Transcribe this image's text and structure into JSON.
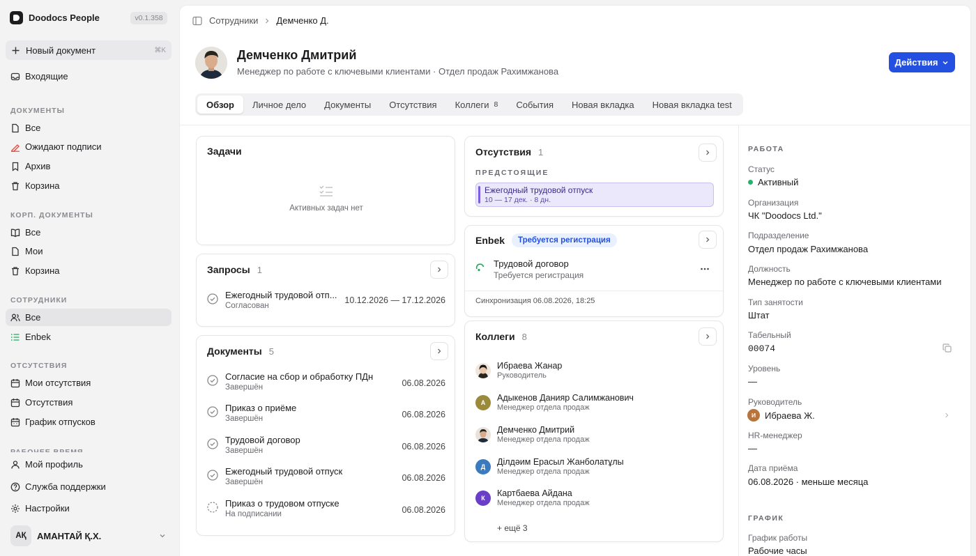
{
  "app": {
    "name": "Doodocs People",
    "version": "v0.1.358"
  },
  "sidebar": {
    "new_document": {
      "label": "Новый документ",
      "shortcut": "⌘K"
    },
    "inbox": "Входящие",
    "sections": [
      {
        "title": "ДОКУМЕНТЫ",
        "items": [
          "Все",
          "Ожидают подписи",
          "Архив",
          "Корзина"
        ]
      },
      {
        "title": "КОРП. ДОКУМЕНТЫ",
        "items": [
          "Все",
          "Мои",
          "Корзина"
        ]
      },
      {
        "title": "СОТРУДНИКИ",
        "items": [
          "Все",
          "Enbek"
        ]
      },
      {
        "title": "ОТСУТСТВИЯ",
        "items": [
          "Мои отсутствия",
          "Отсутствия",
          "График отпусков"
        ]
      },
      {
        "title": "РАБОЧЕЕ ВРЕМЯ",
        "items": []
      }
    ],
    "bottom": [
      "Мой профиль",
      "Служба поддержки",
      "Настройки"
    ],
    "user": {
      "initials": "AҚ",
      "name": "АМАНТАЙ Қ.Х."
    }
  },
  "breadcrumb": {
    "parent": "Сотрудники",
    "current": "Демченко Д."
  },
  "employee": {
    "name": "Демченко Дмитрий",
    "subtitle": "Менеджер по работе с ключевыми клиентами · Отдел продаж Рахимжанова",
    "actions_label": "Действия"
  },
  "tabs": [
    {
      "label": "Обзор",
      "count": ""
    },
    {
      "label": "Личное дело",
      "count": ""
    },
    {
      "label": "Документы",
      "count": ""
    },
    {
      "label": "Отсутствия",
      "count": ""
    },
    {
      "label": "Коллеги",
      "count": "8"
    },
    {
      "label": "События",
      "count": ""
    },
    {
      "label": "Новая вкладка",
      "count": ""
    },
    {
      "label": "Новая вкладка test",
      "count": ""
    }
  ],
  "tasks": {
    "title": "Задачи",
    "empty": "Активных задач нет"
  },
  "requests": {
    "title": "Запросы",
    "count": "1",
    "items": [
      {
        "title": "Ежегодный трудовой отп...",
        "status": "Согласован",
        "dates": "10.12.2026 — 17.12.2026"
      }
    ]
  },
  "documents": {
    "title": "Документы",
    "count": "5",
    "items": [
      {
        "title": "Согласие на сбор и обработку ПДн",
        "status": "Завершён",
        "date": "06.08.2026"
      },
      {
        "title": "Приказ о приёме",
        "status": "Завершён",
        "date": "06.08.2026"
      },
      {
        "title": "Трудовой договор",
        "status": "Завершён",
        "date": "06.08.2026"
      },
      {
        "title": "Ежегодный трудовой отпуск",
        "status": "Завершён",
        "date": "06.08.2026"
      },
      {
        "title": "Приказ о трудовом отпуске",
        "status": "На подписании",
        "date": "06.08.2026"
      }
    ]
  },
  "absences": {
    "title": "Отсутствия",
    "count": "1",
    "section": "ПРЕДСТОЯЩИЕ",
    "upcoming": {
      "title": "Ежегодный трудовой отпуск",
      "period": "10 — 17 дек. · 8 дн."
    }
  },
  "enbek": {
    "title": "Enbek",
    "badge": "Требуется регистрация",
    "item_title": "Трудовой договор",
    "item_status": "Требуется регистрация",
    "sync": "Синхронизация 06.08.2026, 18:25"
  },
  "colleagues": {
    "title": "Коллеги",
    "count": "8",
    "items": [
      {
        "name": "Ибраева Жанар",
        "role": "Руководитель",
        "initial": "",
        "color": "#f0e6dc"
      },
      {
        "name": "Адыкенов Данияр Салимжанович",
        "role": "Менеджер отдела продаж",
        "initial": "А",
        "color": "#9a8a3a"
      },
      {
        "name": "Демченко Дмитрий",
        "role": "Менеджер отдела продаж",
        "initial": "",
        "color": "#e8e2da"
      },
      {
        "name": "Ділдәим Ерасыл Жанболатұлы",
        "role": "Менеджер отдела продаж",
        "initial": "Д",
        "color": "#3a7bbf"
      },
      {
        "name": "Картбаева Айдана",
        "role": "Менеджер отдела продаж",
        "initial": "К",
        "color": "#6a3fc8"
      }
    ],
    "more": "+ ещё 3"
  },
  "work": {
    "title": "РАБОТА",
    "fields": [
      {
        "label": "Статус",
        "value": "Активный"
      },
      {
        "label": "Организация",
        "value": "ЧК \"Doodocs Ltd.\""
      },
      {
        "label": "Подразделение",
        "value": "Отдел продаж Рахимжанова"
      },
      {
        "label": "Должность",
        "value": "Менеджер по работе с ключевыми клиентами"
      },
      {
        "label": "Тип занятости",
        "value": "Штат"
      },
      {
        "label": "Табельный",
        "value": "00074"
      },
      {
        "label": "Уровень",
        "value": "—"
      },
      {
        "label": "Руководитель",
        "value": "Ибраева Ж.",
        "initial": "И"
      },
      {
        "label": "HR-менеджер",
        "value": "—"
      },
      {
        "label": "Дата приёма",
        "value": "06.08.2026 · меньше месяца"
      }
    ]
  },
  "schedule": {
    "title": "ГРАФИК",
    "label": "График работы",
    "value": "Рабочие часы"
  },
  "colors": {
    "accent": "#2350e0",
    "active": "#22b36a",
    "absence": "#7c5fe0"
  }
}
